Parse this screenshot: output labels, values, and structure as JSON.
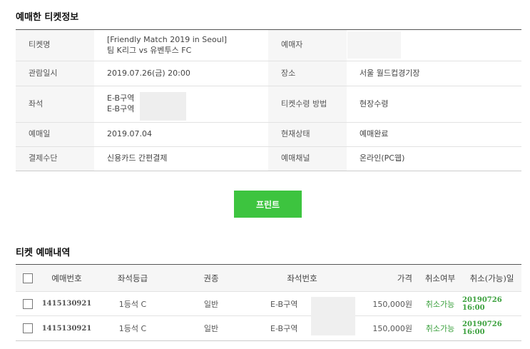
{
  "ticket_info": {
    "title": "예매한 티켓정보",
    "rows": [
      {
        "label1": "티켓명",
        "value1_line1": "[Friendly Match 2019 in Seoul]",
        "value1_line2": "팀 K리그 vs 유벤투스 FC",
        "label2": "예매자",
        "value2": ""
      },
      {
        "label1": "관람일시",
        "value1": "2019.07.26(금) 20:00",
        "label2": "장소",
        "value2": "서울 월드컵경기장"
      },
      {
        "label1": "좌석",
        "value1_line1": "E-B구역",
        "value1_line2": "E-B구역",
        "label2": "티켓수령 방법",
        "value2": "현장수령"
      },
      {
        "label1": "예매일",
        "value1": "2019.07.04",
        "label2": "현재상태",
        "value2": "예매완료"
      },
      {
        "label1": "결제수단",
        "value1": "신용카드 간편결제",
        "label2": "예매채널",
        "value2": "온라인(PC웹)"
      }
    ]
  },
  "print_button": "프린트",
  "history": {
    "title": "티켓 예매내역",
    "headers": [
      "예매번호",
      "좌석등급",
      "권종",
      "좌석번호",
      "가격",
      "취소여부",
      "취소(가능)일"
    ],
    "rows": [
      {
        "booking_no": "1415130921",
        "grade": "1등석 C",
        "ticket_type": "일반",
        "seat": "E-B구역",
        "price": "150,000원",
        "cancel": "취소가능",
        "cancel_date": "20190726 16:00"
      },
      {
        "booking_no": "1415130921",
        "grade": "1등석 C",
        "ticket_type": "일반",
        "seat": "E-B구역",
        "price": "150,000원",
        "cancel": "취소가능",
        "cancel_date": "20190726 16:00"
      }
    ]
  },
  "colors": {
    "accent_green": "#3dc43f",
    "cancel_green": "#3aa03c"
  }
}
